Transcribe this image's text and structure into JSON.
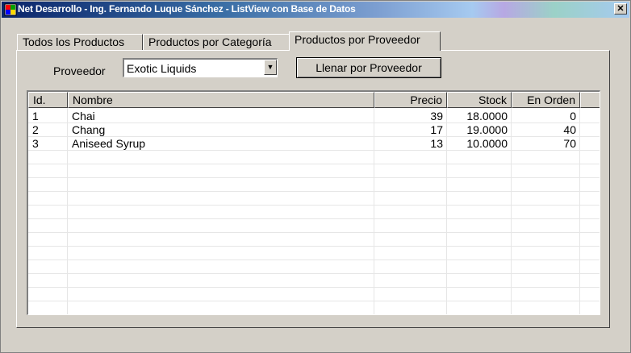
{
  "window": {
    "title": "Net Desarrollo  - Ing. Fernando Luque Sánchez - ListView con Base de Datos",
    "close_label": "✕"
  },
  "tabs": [
    {
      "label": "Todos los Productos"
    },
    {
      "label": "Productos por Categoría"
    },
    {
      "label": "Productos por Proveedor"
    }
  ],
  "active_tab": "Productos por Proveedor",
  "filter": {
    "label": "Proveedor",
    "selected": "Exotic Liquids",
    "button_label": "Llenar por Proveedor"
  },
  "listview": {
    "columns": [
      "Id.",
      "Nombre",
      "Precio",
      "Stock",
      "En Orden"
    ],
    "rows": [
      [
        "1",
        "Chai",
        "39",
        "18.0000",
        "0"
      ],
      [
        "2",
        "Chang",
        "17",
        "19.0000",
        "40"
      ],
      [
        "3",
        "Aniseed Syrup",
        "13",
        "10.0000",
        "70"
      ]
    ]
  },
  "icons": {
    "app": "app-window-icon",
    "dropdown": "chevron-down-icon"
  }
}
